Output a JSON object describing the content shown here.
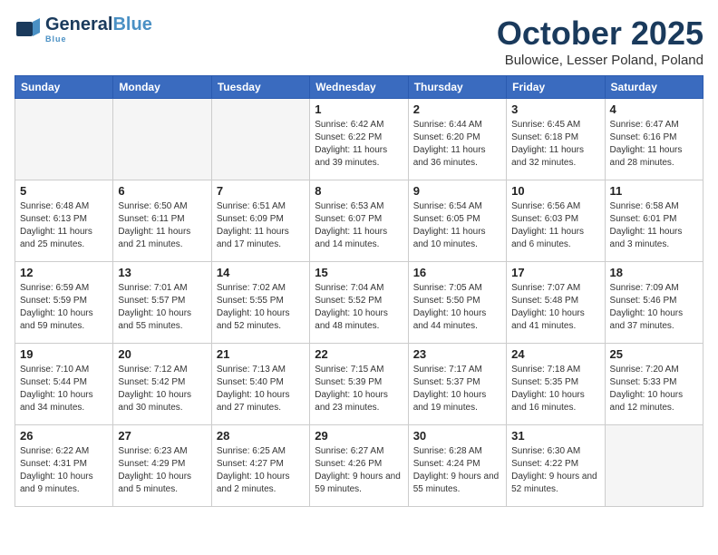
{
  "header": {
    "logo_line1": "General",
    "logo_line1_colored": "Blue",
    "logo_tagline": "Blue",
    "title": "October 2025",
    "subtitle": "Bulowice, Lesser Poland, Poland"
  },
  "weekdays": [
    "Sunday",
    "Monday",
    "Tuesday",
    "Wednesday",
    "Thursday",
    "Friday",
    "Saturday"
  ],
  "weeks": [
    [
      {
        "day": "",
        "info": ""
      },
      {
        "day": "",
        "info": ""
      },
      {
        "day": "",
        "info": ""
      },
      {
        "day": "1",
        "info": "Sunrise: 6:42 AM\nSunset: 6:22 PM\nDaylight: 11 hours\nand 39 minutes."
      },
      {
        "day": "2",
        "info": "Sunrise: 6:44 AM\nSunset: 6:20 PM\nDaylight: 11 hours\nand 36 minutes."
      },
      {
        "day": "3",
        "info": "Sunrise: 6:45 AM\nSunset: 6:18 PM\nDaylight: 11 hours\nand 32 minutes."
      },
      {
        "day": "4",
        "info": "Sunrise: 6:47 AM\nSunset: 6:16 PM\nDaylight: 11 hours\nand 28 minutes."
      }
    ],
    [
      {
        "day": "5",
        "info": "Sunrise: 6:48 AM\nSunset: 6:13 PM\nDaylight: 11 hours\nand 25 minutes."
      },
      {
        "day": "6",
        "info": "Sunrise: 6:50 AM\nSunset: 6:11 PM\nDaylight: 11 hours\nand 21 minutes."
      },
      {
        "day": "7",
        "info": "Sunrise: 6:51 AM\nSunset: 6:09 PM\nDaylight: 11 hours\nand 17 minutes."
      },
      {
        "day": "8",
        "info": "Sunrise: 6:53 AM\nSunset: 6:07 PM\nDaylight: 11 hours\nand 14 minutes."
      },
      {
        "day": "9",
        "info": "Sunrise: 6:54 AM\nSunset: 6:05 PM\nDaylight: 11 hours\nand 10 minutes."
      },
      {
        "day": "10",
        "info": "Sunrise: 6:56 AM\nSunset: 6:03 PM\nDaylight: 11 hours\nand 6 minutes."
      },
      {
        "day": "11",
        "info": "Sunrise: 6:58 AM\nSunset: 6:01 PM\nDaylight: 11 hours\nand 3 minutes."
      }
    ],
    [
      {
        "day": "12",
        "info": "Sunrise: 6:59 AM\nSunset: 5:59 PM\nDaylight: 10 hours\nand 59 minutes."
      },
      {
        "day": "13",
        "info": "Sunrise: 7:01 AM\nSunset: 5:57 PM\nDaylight: 10 hours\nand 55 minutes."
      },
      {
        "day": "14",
        "info": "Sunrise: 7:02 AM\nSunset: 5:55 PM\nDaylight: 10 hours\nand 52 minutes."
      },
      {
        "day": "15",
        "info": "Sunrise: 7:04 AM\nSunset: 5:52 PM\nDaylight: 10 hours\nand 48 minutes."
      },
      {
        "day": "16",
        "info": "Sunrise: 7:05 AM\nSunset: 5:50 PM\nDaylight: 10 hours\nand 44 minutes."
      },
      {
        "day": "17",
        "info": "Sunrise: 7:07 AM\nSunset: 5:48 PM\nDaylight: 10 hours\nand 41 minutes."
      },
      {
        "day": "18",
        "info": "Sunrise: 7:09 AM\nSunset: 5:46 PM\nDaylight: 10 hours\nand 37 minutes."
      }
    ],
    [
      {
        "day": "19",
        "info": "Sunrise: 7:10 AM\nSunset: 5:44 PM\nDaylight: 10 hours\nand 34 minutes."
      },
      {
        "day": "20",
        "info": "Sunrise: 7:12 AM\nSunset: 5:42 PM\nDaylight: 10 hours\nand 30 minutes."
      },
      {
        "day": "21",
        "info": "Sunrise: 7:13 AM\nSunset: 5:40 PM\nDaylight: 10 hours\nand 27 minutes."
      },
      {
        "day": "22",
        "info": "Sunrise: 7:15 AM\nSunset: 5:39 PM\nDaylight: 10 hours\nand 23 minutes."
      },
      {
        "day": "23",
        "info": "Sunrise: 7:17 AM\nSunset: 5:37 PM\nDaylight: 10 hours\nand 19 minutes."
      },
      {
        "day": "24",
        "info": "Sunrise: 7:18 AM\nSunset: 5:35 PM\nDaylight: 10 hours\nand 16 minutes."
      },
      {
        "day": "25",
        "info": "Sunrise: 7:20 AM\nSunset: 5:33 PM\nDaylight: 10 hours\nand 12 minutes."
      }
    ],
    [
      {
        "day": "26",
        "info": "Sunrise: 6:22 AM\nSunset: 4:31 PM\nDaylight: 10 hours\nand 9 minutes."
      },
      {
        "day": "27",
        "info": "Sunrise: 6:23 AM\nSunset: 4:29 PM\nDaylight: 10 hours\nand 5 minutes."
      },
      {
        "day": "28",
        "info": "Sunrise: 6:25 AM\nSunset: 4:27 PM\nDaylight: 10 hours\nand 2 minutes."
      },
      {
        "day": "29",
        "info": "Sunrise: 6:27 AM\nSunset: 4:26 PM\nDaylight: 9 hours\nand 59 minutes."
      },
      {
        "day": "30",
        "info": "Sunrise: 6:28 AM\nSunset: 4:24 PM\nDaylight: 9 hours\nand 55 minutes."
      },
      {
        "day": "31",
        "info": "Sunrise: 6:30 AM\nSunset: 4:22 PM\nDaylight: 9 hours\nand 52 minutes."
      },
      {
        "day": "",
        "info": ""
      }
    ]
  ]
}
